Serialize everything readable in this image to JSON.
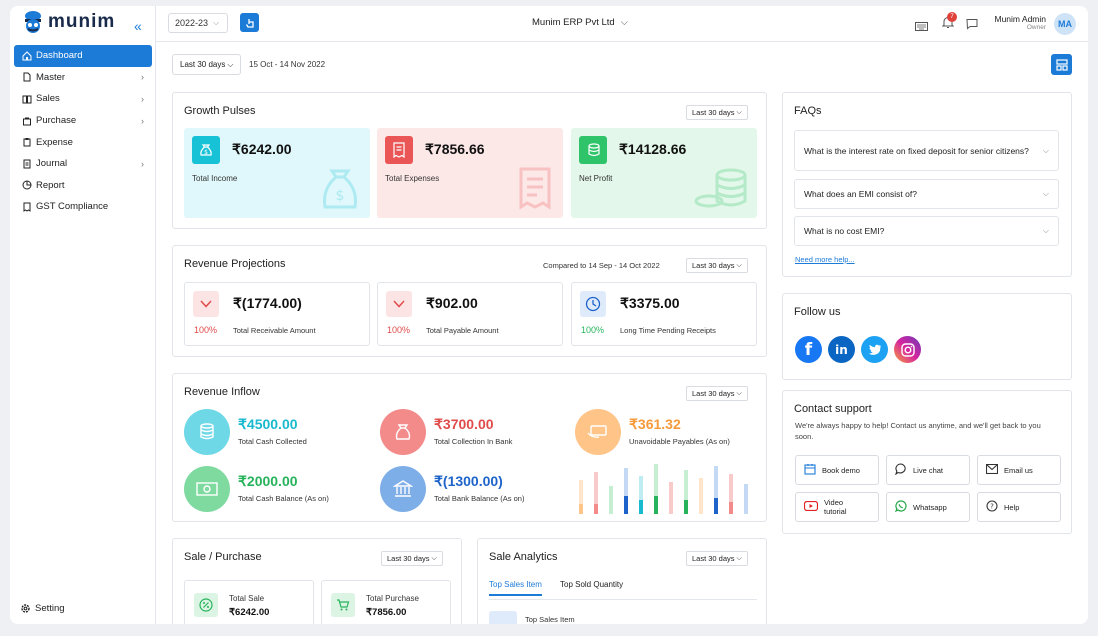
{
  "brand": {
    "name": "munim"
  },
  "sidebar": {
    "items": [
      {
        "label": "Dashboard",
        "icon": "home-icon",
        "chevron": false,
        "active": true
      },
      {
        "label": "Master",
        "icon": "file-icon",
        "chevron": true
      },
      {
        "label": "Sales",
        "icon": "book-icon",
        "chevron": true
      },
      {
        "label": "Purchase",
        "icon": "bag-icon",
        "chevron": true
      },
      {
        "label": "Expense",
        "icon": "clipboard-icon",
        "chevron": false
      },
      {
        "label": "Journal",
        "icon": "journal-icon",
        "chevron": true
      },
      {
        "label": "Report",
        "icon": "pie-icon",
        "chevron": false
      },
      {
        "label": "GST Compliance",
        "icon": "receipt-icon",
        "chevron": false
      }
    ],
    "setting_label": "Setting"
  },
  "topbar": {
    "year": "2022-23",
    "company": "Munim ERP Pvt Ltd",
    "notification_count": "7",
    "user_name": "Munim Admin",
    "user_role": "Owner",
    "avatar_initials": "MA"
  },
  "filter": {
    "label": "Last 30 days",
    "range": "15 Oct - 14 Nov 2022"
  },
  "growth": {
    "title": "Growth Pulses",
    "dropdown": "Last 30 days",
    "cards": [
      {
        "amount": "₹6242.00",
        "label": "Total Income",
        "bg": "#e0f8fb",
        "icon_bg": "#18c2d6"
      },
      {
        "amount": "₹7856.66",
        "label": "Total Expenses",
        "bg": "#fde8e8",
        "icon_bg": "#ea5656"
      },
      {
        "amount": "₹14128.66",
        "label": "Net Profit",
        "bg": "#e3f7ea",
        "icon_bg": "#2fc46a"
      }
    ]
  },
  "projections": {
    "title": "Revenue Projections",
    "compared": "Compared to 14 Sep - 14 Oct 2022",
    "dropdown": "Last 30 days",
    "cards": [
      {
        "amount": "₹(1774.00)",
        "pct": "100%",
        "label": "Total Receivable Amount",
        "pct_color": "#e04b4b"
      },
      {
        "amount": "₹902.00",
        "pct": "100%",
        "label": "Total Payable Amount",
        "pct_color": "#e04b4b"
      },
      {
        "amount": "₹3375.00",
        "pct": "100%",
        "label": "Long Time Pending Receipts",
        "pct_color": "#27b35c"
      }
    ]
  },
  "inflow": {
    "title": "Revenue Inflow",
    "dropdown": "Last 30 days",
    "items": [
      {
        "amount": "₹4500.00",
        "label": "Total Cash Collected",
        "color": "#19b9cf",
        "circle": "#6ed8e6"
      },
      {
        "amount": "₹3700.00",
        "label": "Total Collection In Bank",
        "color": "#e04b4b",
        "circle": "#f38b8b"
      },
      {
        "amount": "₹361.32",
        "label": "Unavoidable Payables (As on)",
        "color": "#f59a3a",
        "circle": "#ffc488"
      },
      {
        "amount": "₹2000.00",
        "label": "Total Cash Balance (As on)",
        "color": "#27b35c",
        "circle": "#7fdaa0"
      },
      {
        "amount": "₹(1300.00)",
        "label": "Total Bank Balance (As on)",
        "color": "#1d63c9",
        "circle": "#7eaee8"
      }
    ]
  },
  "sale_purchase": {
    "title": "Sale / Purchase",
    "dropdown": "Last 30 days",
    "total_sale_label": "Total Sale",
    "total_sale": "₹6242.00",
    "total_purchase_label": "Total Purchase",
    "total_purchase": "₹7856.00"
  },
  "analytics": {
    "title": "Sale Analytics",
    "dropdown": "Last 30 days",
    "tab1": "Top Sales Item",
    "tab2": "Top Sold Quantity",
    "row_label": "Top Sales Item"
  },
  "faqs": {
    "title": "FAQs",
    "items": [
      "What is the interest rate on fixed deposit for senior citizens?",
      "What does an EMI consist of?",
      "What is no cost EMI?"
    ],
    "more": "Need more help..."
  },
  "follow": {
    "title": "Follow us",
    "icons": [
      "facebook-icon",
      "linkedin-icon",
      "twitter-icon",
      "instagram-icon"
    ]
  },
  "support": {
    "title": "Contact support",
    "text": "We're always happy to help! Contact us anytime, and we'll get back to you soon.",
    "buttons": [
      "Book demo",
      "Live chat",
      "Email us",
      "Video tutorial",
      "Whatsapp",
      "Help"
    ]
  }
}
